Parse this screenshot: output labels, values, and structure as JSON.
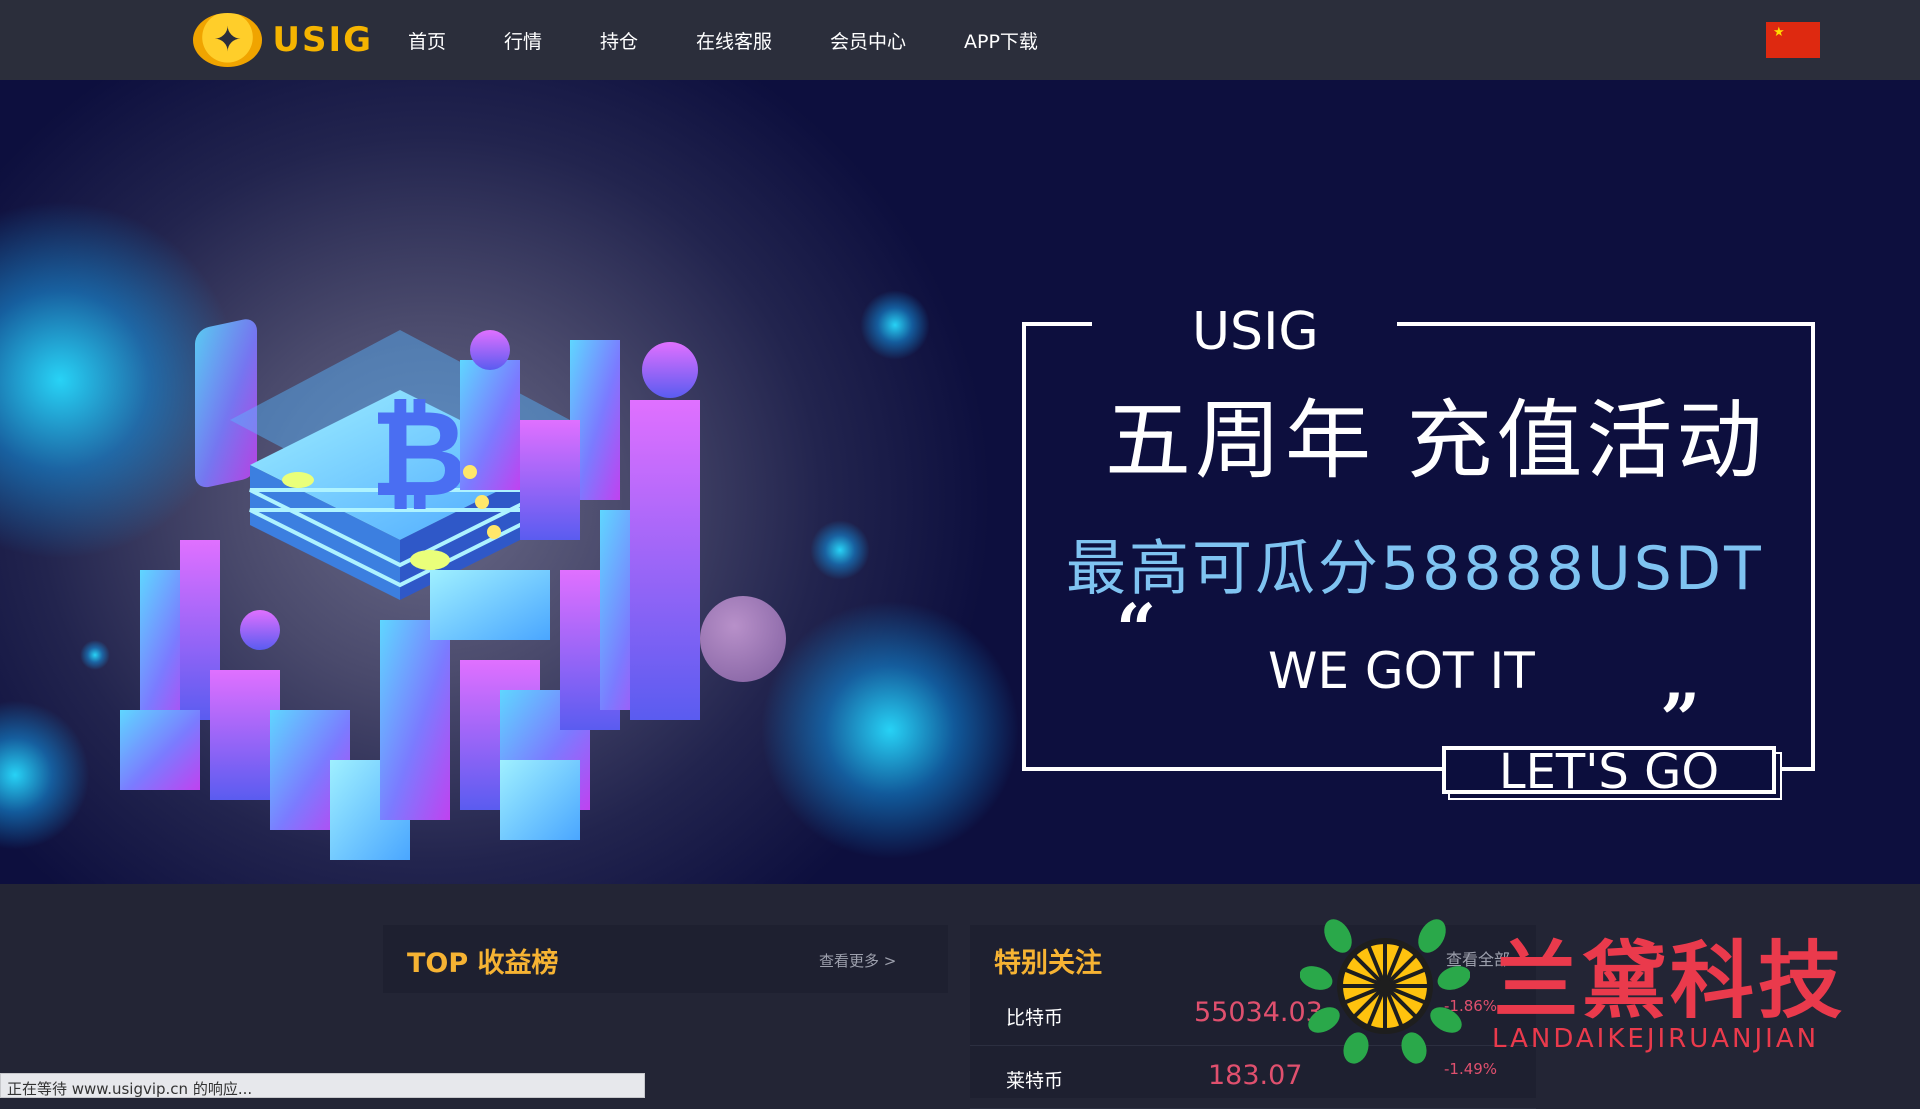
{
  "brand": {
    "name": "USIG"
  },
  "nav": {
    "items": [
      "首页",
      "行情",
      "持仓",
      "在线客服",
      "会员中心",
      "APP下载"
    ],
    "language_flag": "cn-flag"
  },
  "banner": {
    "brand": "USIG",
    "title": "五周年 充值活动",
    "subtitle": "最高可瓜分58888USDT",
    "quote_open": "“",
    "tagline": "WE GOT IT",
    "quote_close": "”",
    "cta": "LET'S GO",
    "carousel": {
      "count": 3,
      "active": 0
    }
  },
  "top_earnings": {
    "title": "TOP 收益榜",
    "more": "查看更多 >"
  },
  "special_watch": {
    "title": "特别关注",
    "more": "查看全部",
    "rows": [
      {
        "name": "比特币",
        "price": "55034.03",
        "change": "-1.86%"
      },
      {
        "name": "莱特币",
        "price": "183.07",
        "change": "-1.49%"
      }
    ]
  },
  "watermark": {
    "cn": "兰黛科技",
    "en": "LANDAIKEJIRUANJIAN"
  },
  "status_bar": {
    "text": "正在等待 www.usigvip.cn 的响应..."
  },
  "colors": {
    "accent_gold": "#f6b333",
    "price_red": "#e0506e",
    "carousel_active": "#1f7ce6",
    "banner_sub": "#7fc3f1"
  }
}
